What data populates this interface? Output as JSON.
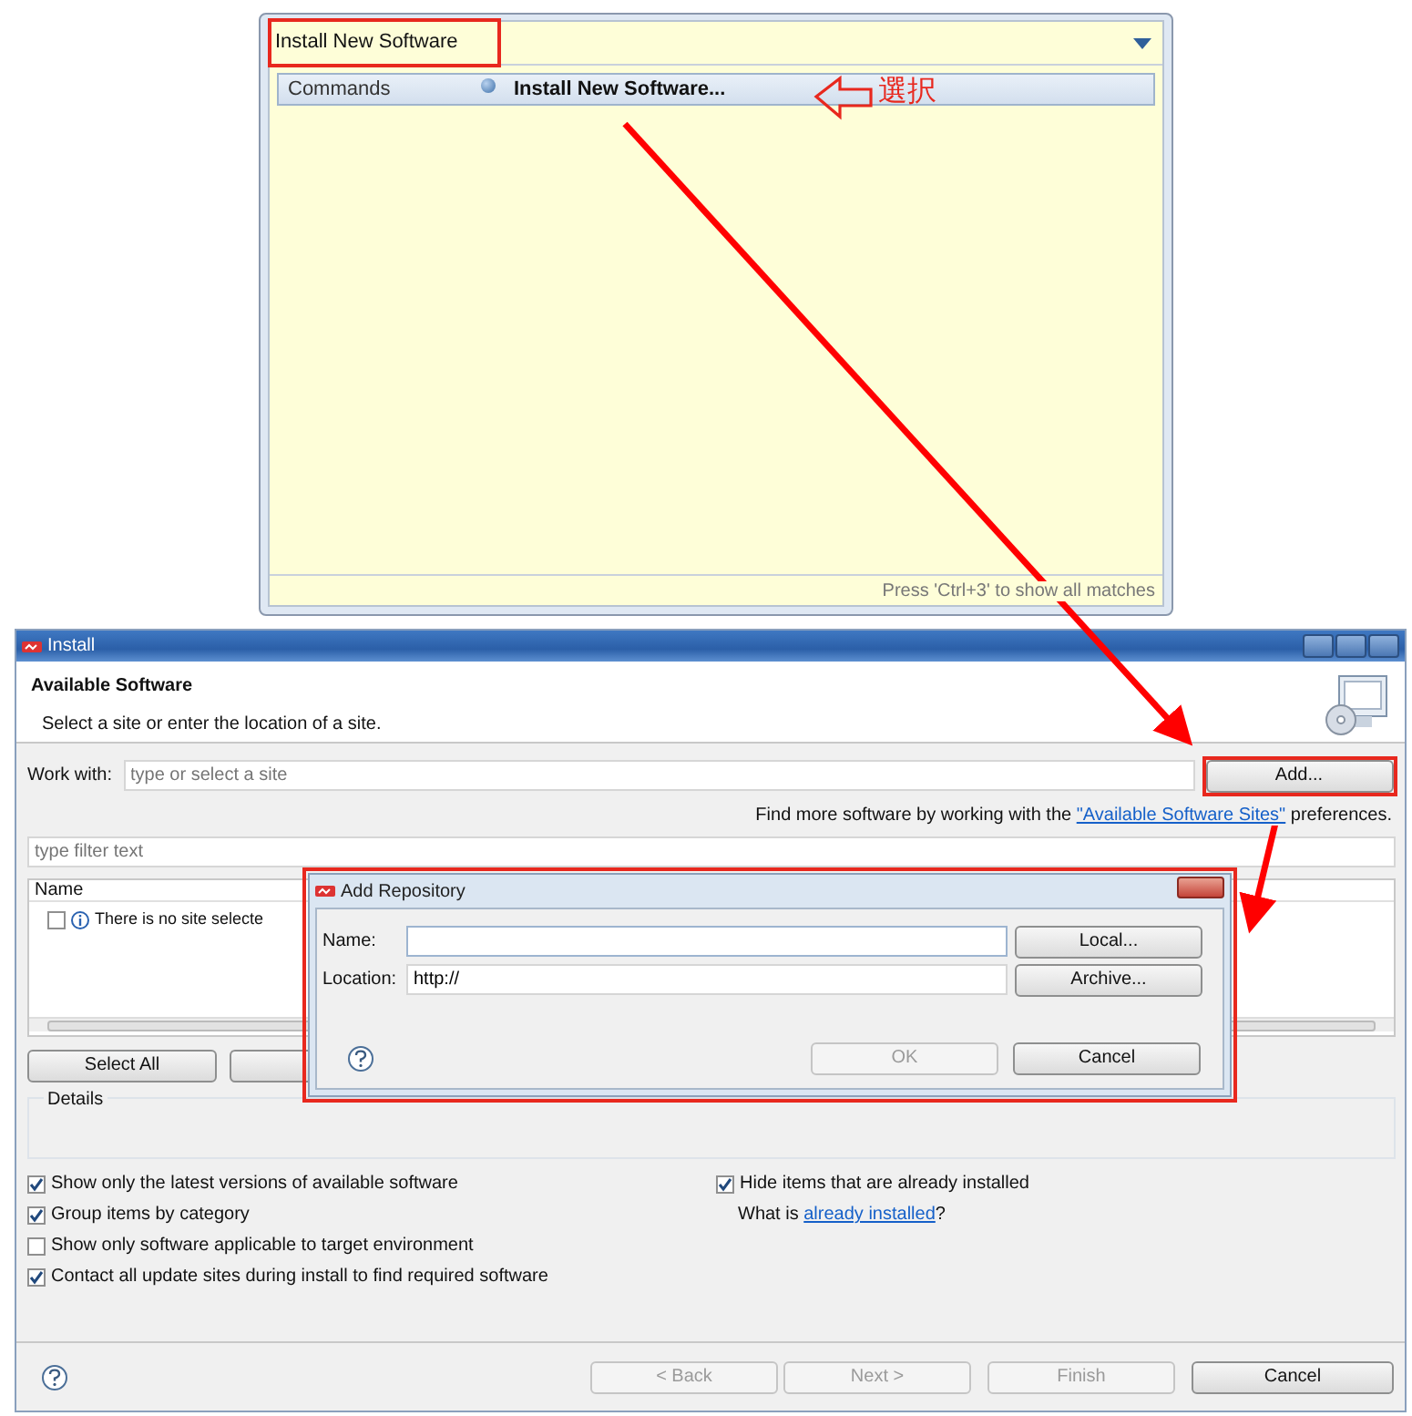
{
  "quick_access": {
    "search_value": "Install New Software",
    "results": [
      {
        "category": "Commands",
        "label": "Install New Software...",
        "selected": true
      }
    ],
    "footer": "Press 'Ctrl+3' to show all matches"
  },
  "annotation": {
    "label": "選択"
  },
  "install_window": {
    "title": "Install",
    "heading": "Available Software",
    "description": "Select a site or enter the location of a site.",
    "work_with": {
      "label": "Work with:",
      "placeholder": "type or select a site"
    },
    "add_button": "Add...",
    "find_more": {
      "before": "Find more software by working with the ",
      "link": "\"Available Software Sites\"",
      "after": " preferences."
    },
    "filter": {
      "placeholder": "type filter text"
    },
    "table": {
      "columns": [
        "Name"
      ],
      "rows": [
        {
          "text": "There is no site selecte",
          "checked": false
        }
      ]
    },
    "select_all": "Select All",
    "details_label": "Details",
    "options": [
      {
        "label": "Show only the latest versions of available software",
        "checked": true
      },
      {
        "label": "Group items by category",
        "checked": true
      },
      {
        "label": "Show only software applicable to target environment",
        "checked": false
      },
      {
        "label": "Contact all update sites during install to find required software",
        "checked": true
      }
    ],
    "hide_installed": {
      "label": "Hide items that are already installed",
      "checked": true
    },
    "what_is": {
      "before": "What is ",
      "link": "already installed",
      "after": "?"
    },
    "buttons": [
      {
        "label": "< Back",
        "disabled": true
      },
      {
        "label": "Next >",
        "disabled": true
      },
      {
        "label": "Finish",
        "disabled": true
      },
      {
        "label": "Cancel",
        "disabled": false
      }
    ]
  },
  "add_repository": {
    "title": "Add Repository",
    "fields": [
      {
        "label": "Name:",
        "button": "Local..."
      },
      {
        "label": "Location:",
        "value": "http://",
        "button": "Archive..."
      }
    ],
    "buttons": [
      {
        "label": "OK",
        "disabled": true
      },
      {
        "label": "Cancel",
        "disabled": false
      }
    ]
  }
}
